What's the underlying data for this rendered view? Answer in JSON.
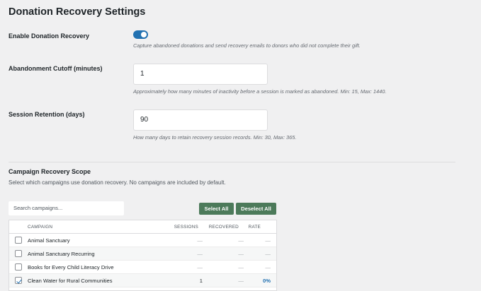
{
  "page": {
    "title": "Donation Recovery Settings"
  },
  "settings": {
    "enable": {
      "label": "Enable Donation Recovery",
      "enabled": true,
      "description": "Capture abandoned donations and send recovery emails to donors who did not complete their gift."
    },
    "cutoff": {
      "label": "Abandonment Cutoff (minutes)",
      "value": "1",
      "description": "Approximately how many minutes of inactivity before a session is marked as abandoned. Min: 15, Max: 1440."
    },
    "retention": {
      "label": "Session Retention (days)",
      "value": "90",
      "description": "How many days to retain recovery session records. Min: 30, Max: 365."
    }
  },
  "scope": {
    "title": "Campaign Recovery Scope",
    "description": "Select which campaigns use donation recovery. No campaigns are included by default.",
    "search_placeholder": "Search campaigns...",
    "select_all": "Select All",
    "deselect_all": "Deselect All",
    "columns": [
      "CAMPAIGN",
      "SESSIONS",
      "RECOVERED",
      "RATE"
    ],
    "rows": [
      {
        "name": "Animal Sanctuary",
        "checked": false,
        "sessions": "—",
        "recovered": "—",
        "rate": "—"
      },
      {
        "name": "Animal Sanctuary Recurring",
        "checked": false,
        "sessions": "—",
        "recovered": "—",
        "rate": "—"
      },
      {
        "name": "Books for Every Child Literacy Drive",
        "checked": false,
        "sessions": "—",
        "recovered": "—",
        "rate": "—"
      },
      {
        "name": "Clean Water for Rural Communities",
        "checked": true,
        "sessions": "1",
        "recovered": "—",
        "rate": "0%"
      }
    ]
  },
  "colors": {
    "accent": "#2271b1",
    "button": "#4c7a5a"
  }
}
